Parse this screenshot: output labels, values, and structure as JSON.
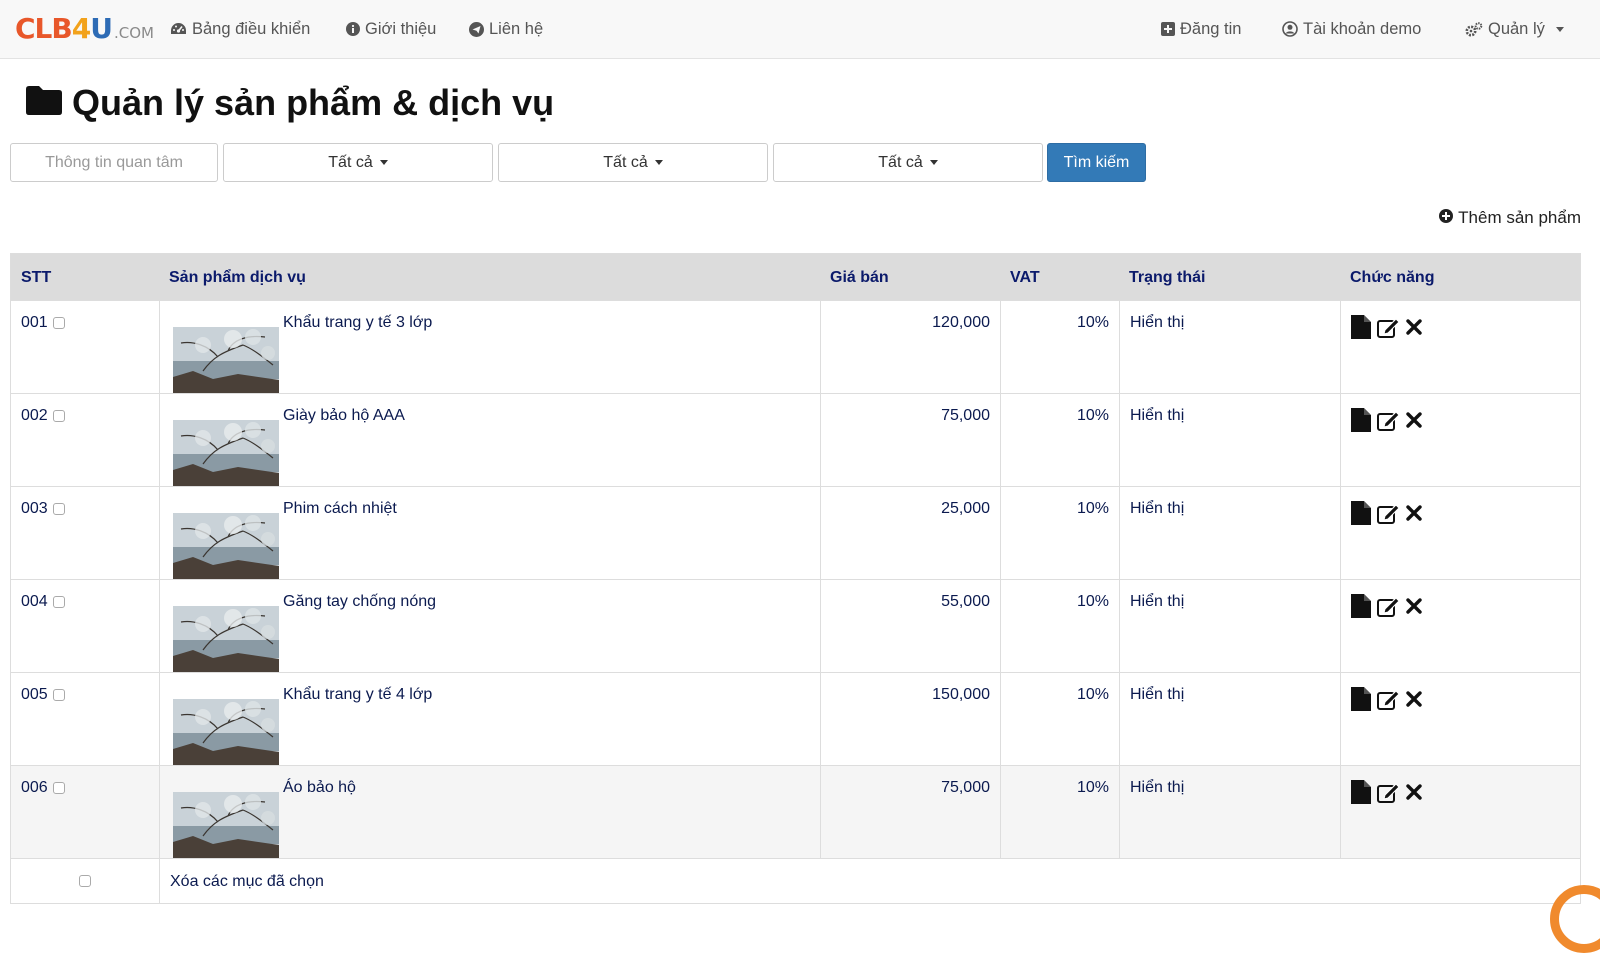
{
  "brand": {
    "clb": "CLB",
    "four": "4",
    "u": "U",
    "com": ".COM"
  },
  "nav": {
    "dashboard": "Bảng điều khiển",
    "about": "Giới thiệu",
    "contact": "Liên hệ",
    "post": "Đăng tin",
    "account": "Tài khoản demo",
    "manage": "Quản lý"
  },
  "page_title": "Quản lý sản phẩm & dịch vụ",
  "search": {
    "placeholder": "Thông tin quan tâm",
    "filter1": "Tất cả",
    "filter2": "Tất cả",
    "filter3": "Tất cả",
    "button": "Tìm kiếm"
  },
  "add_product": "Thêm sản phẩm",
  "table": {
    "headers": [
      "STT",
      "Sản phẩm dịch vụ",
      "Giá bán",
      "VAT",
      "Trạng thái",
      "Chức năng"
    ],
    "rows": [
      {
        "stt": "001",
        "name": "Khẩu trang y tế 3 lớp",
        "price": "120,000",
        "vat": "10%",
        "status": "Hiển thị"
      },
      {
        "stt": "002",
        "name": "Giày bảo hộ AAA",
        "price": "75,000",
        "vat": "10%",
        "status": "Hiển thị"
      },
      {
        "stt": "003",
        "name": "Phim cách nhiệt",
        "price": "25,000",
        "vat": "10%",
        "status": "Hiển thị"
      },
      {
        "stt": "004",
        "name": "Găng tay chống nóng",
        "price": "55,000",
        "vat": "10%",
        "status": "Hiển thị"
      },
      {
        "stt": "005",
        "name": "Khẩu trang y tế 4 lớp",
        "price": "150,000",
        "vat": "10%",
        "status": "Hiển thị"
      },
      {
        "stt": "006",
        "name": "Áo bảo hộ",
        "price": "75,000",
        "vat": "10%",
        "status": "Hiển thị"
      }
    ],
    "delete_selected": "Xóa các mục đã chọn"
  },
  "colors": {
    "primary": "#337ab7",
    "header_bg": "#dcdcdc",
    "text_dark": "#0b1a4f",
    "accent_orange": "#f08a2d"
  },
  "icons": {
    "dashboard": "dashboard-icon",
    "about": "info-circle-icon",
    "contact": "paper-plane-icon",
    "post": "plus-square-icon",
    "account": "user-circle-icon",
    "manage": "gears-icon",
    "title": "folder-icon",
    "add": "plus-circle-icon",
    "view": "file-icon",
    "edit": "edit-icon",
    "delete": "close-icon"
  }
}
